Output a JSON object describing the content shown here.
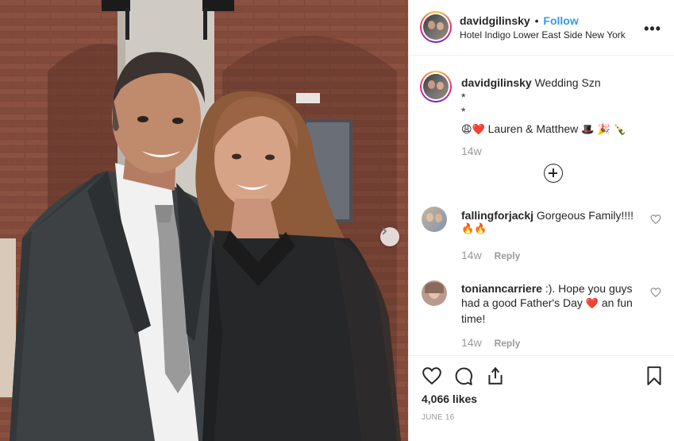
{
  "post": {
    "username": "davidgilinsky",
    "separator": "•",
    "follow_label": "Follow",
    "location": "Hotel Indigo Lower East Side New York",
    "more_label": "•••"
  },
  "caption": {
    "username": "davidgilinsky",
    "text": "Wedding Szn",
    "line2": "*",
    "line3": "*",
    "line4_text": "Lauren & Matthew",
    "emoji_left": "😩❤️",
    "emoji_right": "🎩 🎉 🍾",
    "time": "14w"
  },
  "comments": [
    {
      "username": "fallingforjackj",
      "text": "Gorgeous Family!!!!",
      "text2": "🔥🔥",
      "time": "14w",
      "reply_label": "Reply"
    },
    {
      "username": "tonianncarriere",
      "text": ":). Hope you guys had a good Father's Day",
      "heart": "❤️",
      "text2": "an fun time!",
      "time": "14w",
      "reply_label": "Reply"
    }
  ],
  "footer": {
    "likes": "4,066 likes",
    "date": "JUNE 16"
  },
  "colors": {
    "link_blue": "#3897f0",
    "muted": "#999999",
    "heart_red": "#e0245e"
  },
  "icons": [
    "heart-icon",
    "comment-icon",
    "share-icon",
    "bookmark-icon",
    "more-icon",
    "plus-icon",
    "chevron-right-icon"
  ]
}
